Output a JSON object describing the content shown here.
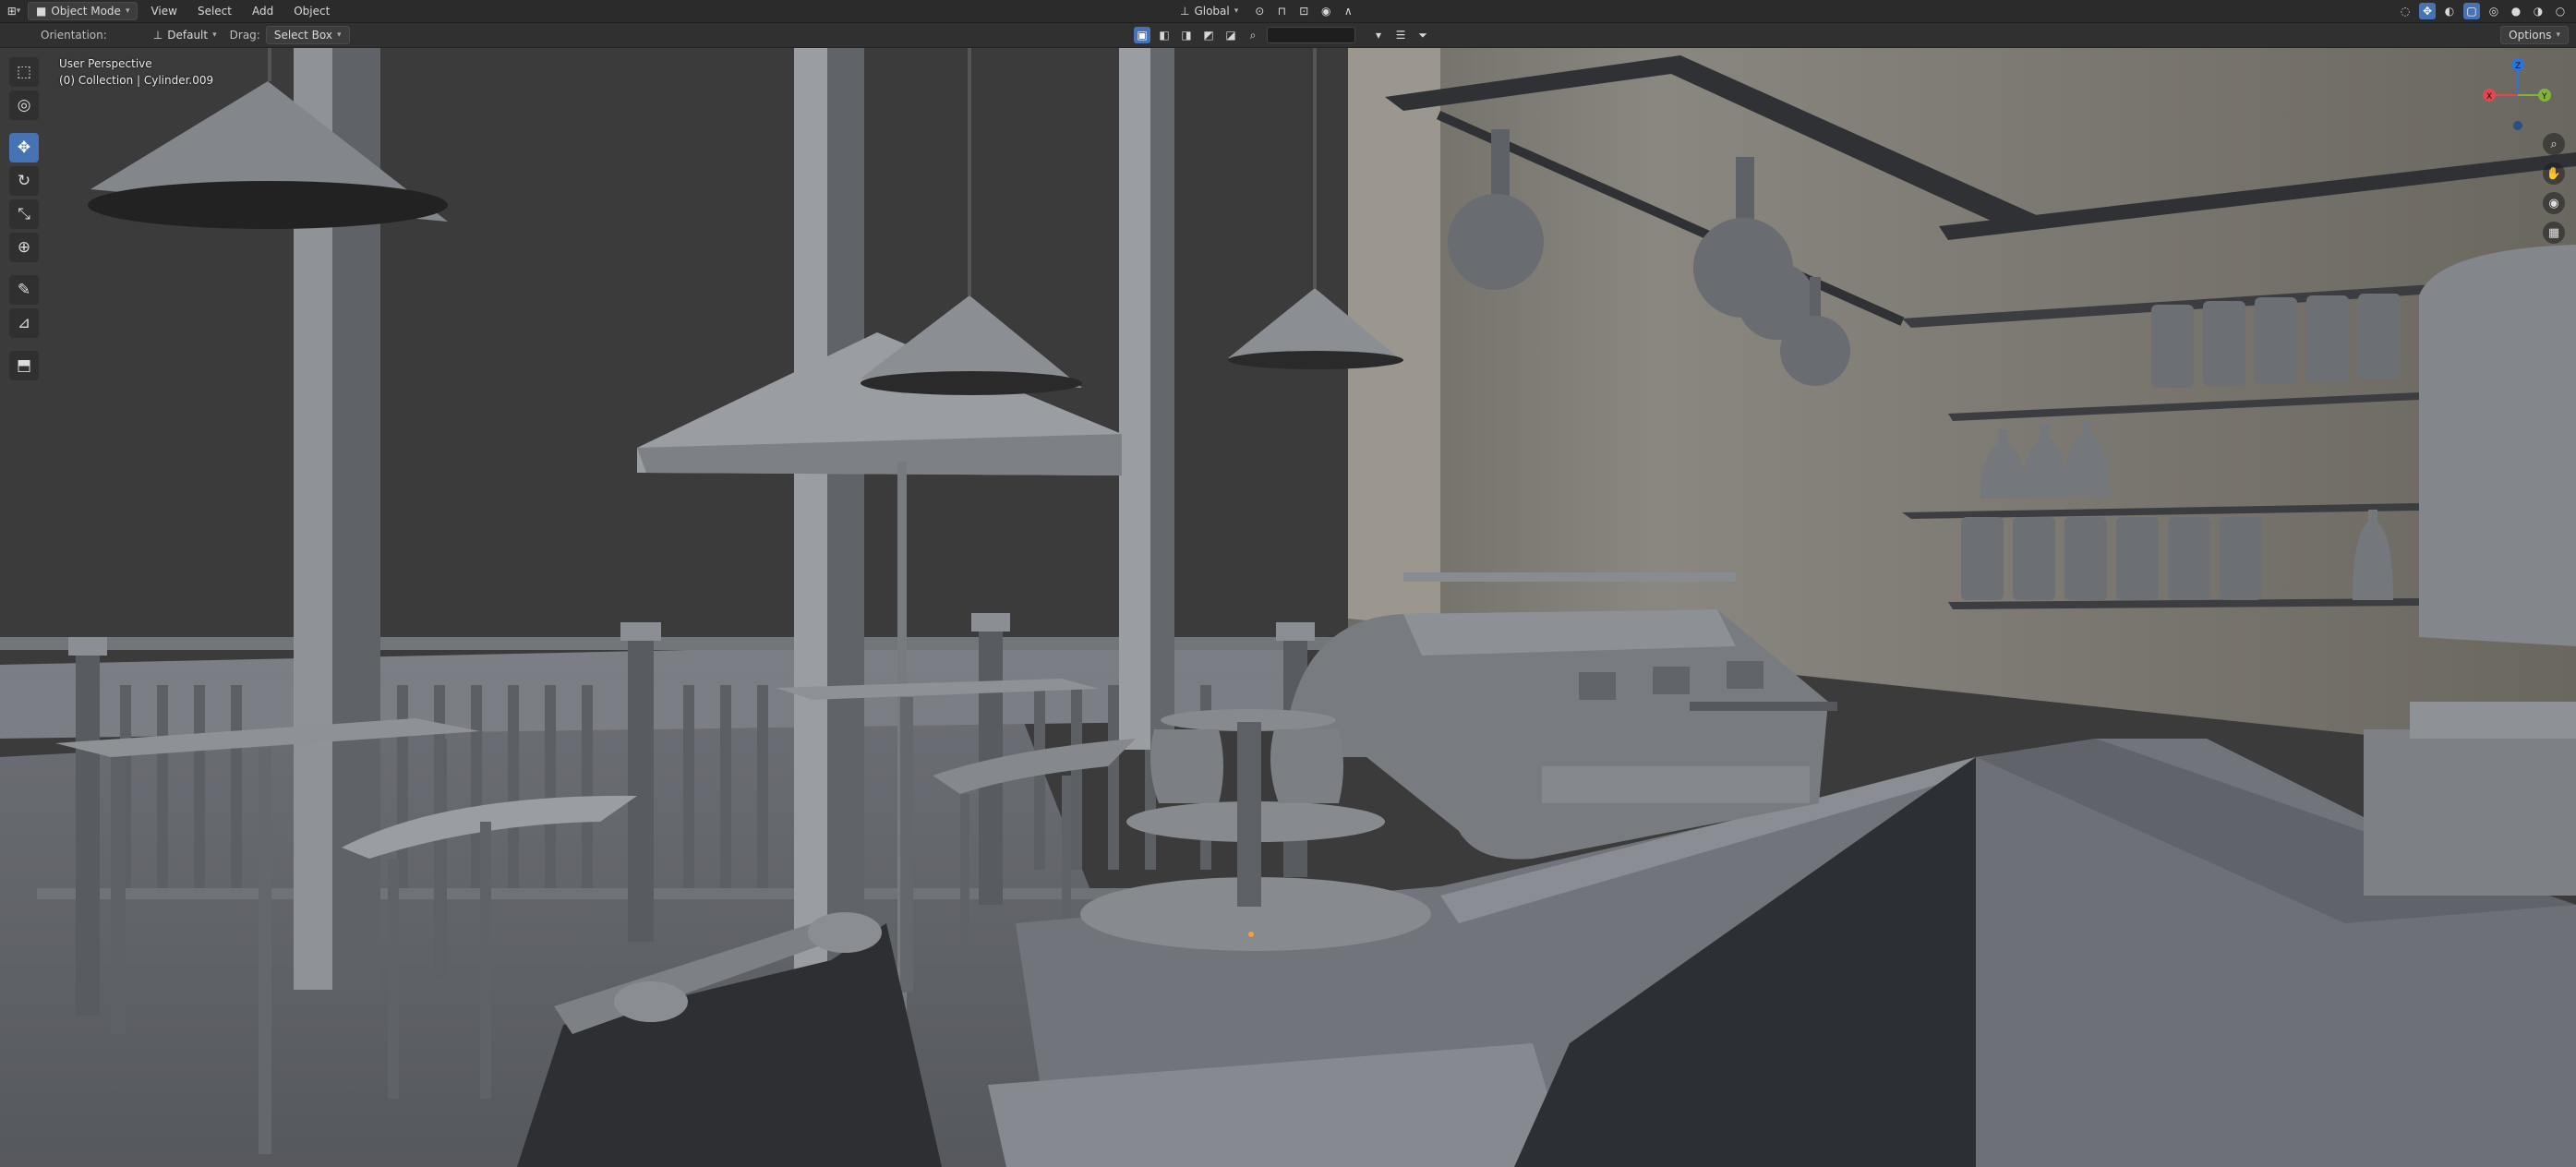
{
  "header": {
    "mode_label": "Object Mode",
    "menus": [
      "View",
      "Select",
      "Add",
      "Object"
    ],
    "transform_orientation": "Global",
    "options_label": "Options"
  },
  "tool_settings": {
    "orientation_label": "Orientation:",
    "orientation_value": "Default",
    "drag_label": "Drag:",
    "drag_value": "Select Box"
  },
  "viewport": {
    "view_name": "User Perspective",
    "active_object": "(0) Collection | Cylinder.009"
  },
  "gizmo": {
    "axes": [
      "X",
      "Y",
      "Z"
    ],
    "colors": {
      "x": "#e2474c",
      "y": "#7fb33a",
      "z": "#2d74d6"
    }
  },
  "toolbar": {
    "tools": [
      "select-box",
      "cursor",
      "move",
      "rotate",
      "scale",
      "transform",
      "annotate",
      "measure",
      "add-cube"
    ],
    "active_tool": "move"
  },
  "nav_buttons": [
    "zoom",
    "pan",
    "camera-view",
    "toggle-perspective"
  ],
  "colors": {
    "header_bg": "#2b2b2b",
    "viewport_sky": "#3a3a3a",
    "active_blue": "#4772b3",
    "wall_tan": "#77746d"
  }
}
